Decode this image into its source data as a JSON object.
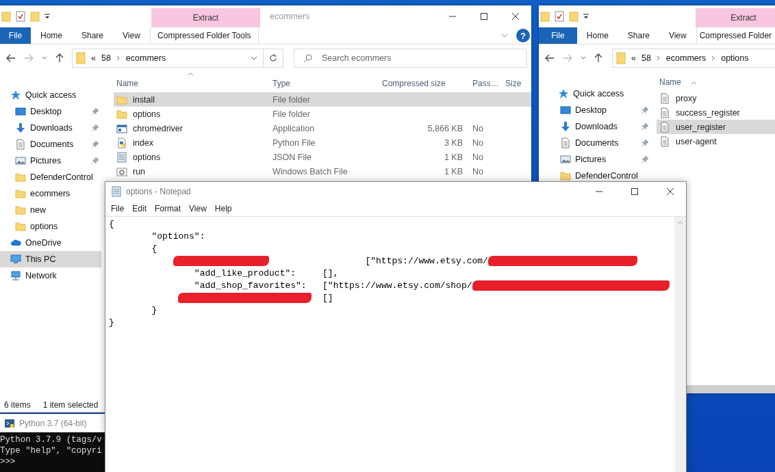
{
  "left_explorer": {
    "title": "ecommers",
    "contextual_header": "Extract",
    "help_button": "?",
    "tabs": [
      {
        "label": "File",
        "kind": "file"
      },
      {
        "label": "Home",
        "kind": "plain"
      },
      {
        "label": "Share",
        "kind": "plain"
      },
      {
        "label": "View",
        "kind": "plain"
      },
      {
        "label": "Compressed Folder Tools",
        "kind": "contextual"
      }
    ],
    "address": {
      "overflow": "«",
      "crumbs": [
        "58",
        "ecommers"
      ]
    },
    "search": {
      "placeholder": "Search ecommers"
    },
    "sidebar": [
      {
        "label": "Quick access",
        "kind": "star",
        "selected": false,
        "children": [
          {
            "label": "Desktop",
            "kind": "desktop",
            "pinned": true,
            "selected": false
          },
          {
            "label": "Downloads",
            "kind": "download",
            "pinned": true,
            "selected": false
          },
          {
            "label": "Documents",
            "kind": "documents",
            "pinned": true,
            "selected": false
          },
          {
            "label": "Pictures",
            "kind": "pictures",
            "pinned": true,
            "selected": false
          },
          {
            "label": "DefenderControl",
            "kind": "folder",
            "pinned": false,
            "selected": false
          },
          {
            "label": "ecommers",
            "kind": "folder",
            "pinned": false,
            "selected": false
          },
          {
            "label": "new",
            "kind": "folder",
            "pinned": false,
            "selected": false
          },
          {
            "label": "options",
            "kind": "folder",
            "pinned": false,
            "selected": false
          }
        ]
      },
      {
        "label": "OneDrive",
        "kind": "cloud",
        "selected": false
      },
      {
        "label": "This PC",
        "kind": "pc",
        "selected": true
      },
      {
        "label": "Network",
        "kind": "network",
        "selected": false
      }
    ],
    "columns": [
      "Name",
      "Type",
      "Compressed size",
      "Pass…",
      "Size"
    ],
    "rows": [
      {
        "kind": "folder",
        "name": "install",
        "type": "File folder",
        "selected": true
      },
      {
        "kind": "folder",
        "name": "options",
        "type": "File folder",
        "selected": false
      },
      {
        "kind": "app",
        "name": "chromedriver",
        "type": "Application",
        "compressed_size": "5,866 KB",
        "password": "No",
        "selected": false
      },
      {
        "kind": "python",
        "name": "index",
        "type": "Python File",
        "compressed_size": "3 KB",
        "password": "No",
        "selected": false
      },
      {
        "kind": "json",
        "name": "options",
        "type": "JSON File",
        "compressed_size": "1 KB",
        "password": "No",
        "selected": false
      },
      {
        "kind": "batch",
        "name": "run",
        "type": "Windows Batch File",
        "compressed_size": "1 KB",
        "password": "No",
        "selected": false
      }
    ],
    "status": [
      "6 items",
      "1 item selected"
    ]
  },
  "right_explorer": {
    "contextual_header": "Extract",
    "tabs": [
      {
        "label": "File",
        "kind": "file"
      },
      {
        "label": "Home",
        "kind": "plain"
      },
      {
        "label": "Share",
        "kind": "plain"
      },
      {
        "label": "View",
        "kind": "plain"
      },
      {
        "label": "Compressed Folder",
        "kind": "contextual"
      }
    ],
    "address": {
      "overflow": "«",
      "crumbs": [
        "58",
        "ecommers",
        "options"
      ]
    },
    "sidebar": [
      {
        "label": "Quick access",
        "kind": "star",
        "selected": false,
        "children": [
          {
            "label": "Desktop",
            "kind": "desktop",
            "pinned": true,
            "selected": false
          },
          {
            "label": "Downloads",
            "kind": "download",
            "pinned": true,
            "selected": false
          },
          {
            "label": "Documents",
            "kind": "documents",
            "pinned": true,
            "selected": false
          },
          {
            "label": "Pictures",
            "kind": "pictures",
            "pinned": true,
            "selected": false
          },
          {
            "label": "DefenderControl",
            "kind": "folder",
            "pinned": false,
            "selected": false
          }
        ]
      }
    ],
    "columns": [
      "Name"
    ],
    "rows": [
      {
        "kind": "text",
        "name": "proxy",
        "selected": false
      },
      {
        "kind": "text",
        "name": "success_register",
        "selected": false
      },
      {
        "kind": "text",
        "name": "user_register",
        "selected": true
      },
      {
        "kind": "text",
        "name": "user-agent",
        "selected": false
      }
    ]
  },
  "python_console": {
    "title": "Python 3.7 (64-bit)",
    "lines": [
      "Python 3.7.9 (tags/v",
      "Type \"help\", \"copyri",
      ">>>"
    ]
  },
  "notepad": {
    "title": "options - Notepad",
    "menu": [
      "File",
      "Edit",
      "Format",
      "View",
      "Help"
    ],
    "lines": [
      [
        {
          "kind": "text",
          "text": "{"
        }
      ],
      [
        {
          "kind": "text",
          "text": "\t\"options\":"
        }
      ],
      [
        {
          "kind": "text",
          "text": "\t{"
        }
      ],
      [
        {
          "kind": "redaction"
        },
        {
          "kind": "text",
          "text": "\t\t\t[\"https://www.etsy.com/"
        },
        {
          "kind": "redaction"
        }
      ],
      [
        {
          "kind": "text",
          "text": "\t\t\"add_like_product\":\t[],"
        }
      ],
      [
        {
          "kind": "text",
          "text": "\t\t\"add_shop_favorites\":\t[\"https://www.etsy.com/shop/"
        },
        {
          "kind": "redaction"
        }
      ],
      [
        {
          "kind": "redaction"
        },
        {
          "kind": "text",
          "text": "\t[]"
        }
      ],
      [
        {
          "kind": "text",
          "text": "\t}"
        }
      ],
      [
        {
          "kind": "text",
          "text": "}"
        }
      ]
    ]
  }
}
